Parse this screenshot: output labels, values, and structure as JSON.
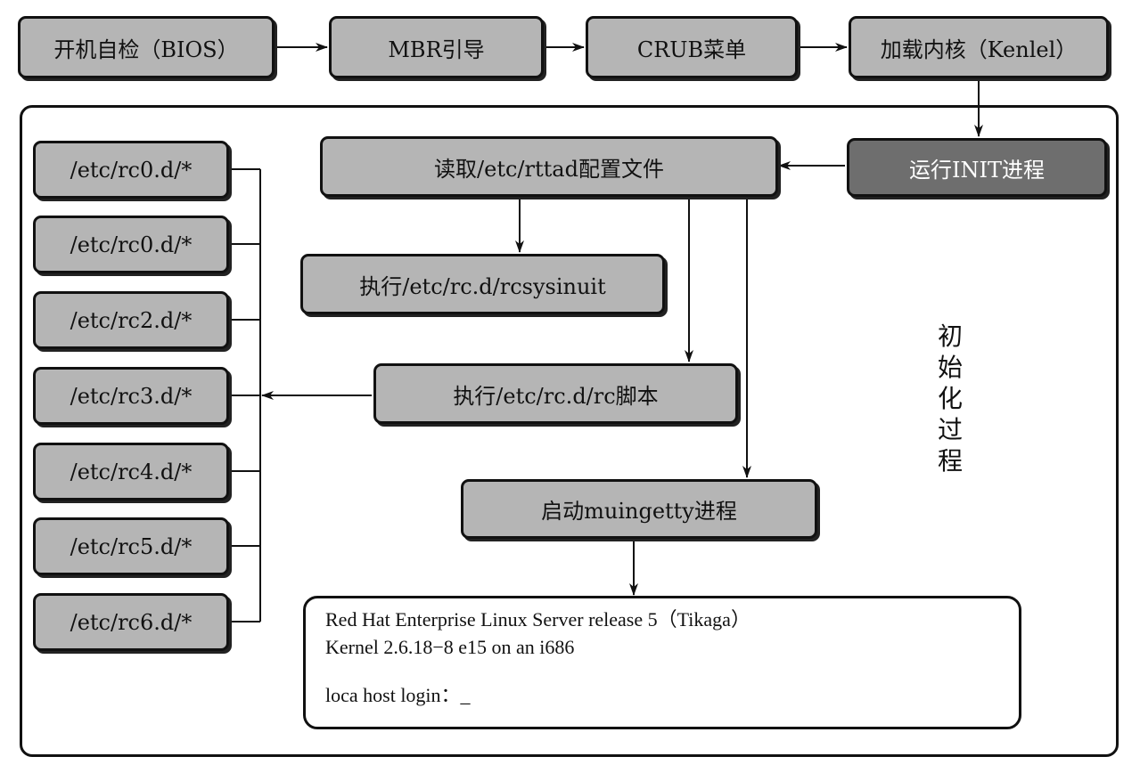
{
  "top_row": [
    {
      "id": "bios",
      "label": "开机自检（BIOS）"
    },
    {
      "id": "mbr",
      "label": "MBR引导"
    },
    {
      "id": "grub",
      "label": "CRUB菜单"
    },
    {
      "id": "kernel",
      "label": "加载内核（Kenlel）"
    }
  ],
  "init_box": {
    "label": "运行INIT进程"
  },
  "read_config": {
    "label": "读取/etc/rttad配置文件"
  },
  "rcsysinit": {
    "label": "执行/etc/rc.d/rcsysinuit"
  },
  "rc_script": {
    "label": "执行/etc/rc.d/rc脚本"
  },
  "mingetty": {
    "label": "启动muingetty进程"
  },
  "runlevel_dirs": [
    "/etc/rc0.d/*",
    "/etc/rc0.d/*",
    "/etc/rc2.d/*",
    "/etc/rc3.d/*",
    "/etc/rc4.d/*",
    "/etc/rc5.d/*",
    "/etc/rc6.d/*"
  ],
  "terminal": {
    "line1": "Red Hat Enterprise Linux Server release 5（Tikaga）",
    "line2": "Kernel 2.6.18−8 e15 on an i686",
    "line3": "loca host login：_"
  },
  "side_label": [
    "初",
    "始",
    "化",
    "过",
    "程"
  ],
  "colors": {
    "box_fill": "#b5b5b5",
    "init_fill": "#6e6e6e",
    "line": "#111111"
  }
}
